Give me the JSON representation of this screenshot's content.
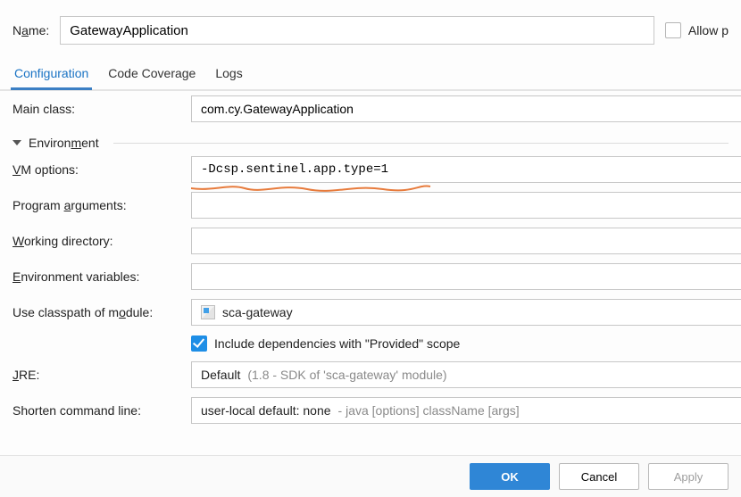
{
  "name": {
    "label_pre": "N",
    "label_u": "a",
    "label_post": "me:",
    "value": "GatewayApplication"
  },
  "allow": {
    "label": "Allow p",
    "checked": false
  },
  "tabs": {
    "t0": "Configuration",
    "t1": "Code Coverage",
    "t2": "Logs"
  },
  "mainClass": {
    "label": "Main class:",
    "value": "com.cy.GatewayApplication"
  },
  "env": {
    "title_pre": "Environ",
    "title_u": "m",
    "title_post": "ent"
  },
  "vm": {
    "label_u": "V",
    "label_post": "M options:",
    "value": "-Dcsp.sentinel.app.type=1"
  },
  "progArgs": {
    "label_pre": "Program ",
    "label_u": "a",
    "label_post": "rguments:",
    "value": ""
  },
  "workDir": {
    "label_u": "W",
    "label_post": "orking directory:",
    "value": ""
  },
  "envVars": {
    "label_u": "E",
    "label_post": "nvironment variables:",
    "value": ""
  },
  "module": {
    "label_pre": "Use classpath of m",
    "label_u": "o",
    "label_post": "dule:",
    "value": "sca-gateway"
  },
  "includeProvided": {
    "checked": true,
    "label": "Include dependencies with \"Provided\" scope"
  },
  "jre": {
    "label_u": "J",
    "label_post": "RE:",
    "value_prefix": "Default ",
    "value_grey": "(1.8 - SDK of 'sca-gateway' module)"
  },
  "shorten": {
    "label": "Shorten command line:",
    "value_prefix": "user-local default: none ",
    "value_grey": "- java [options] className [args]"
  },
  "buttons": {
    "ok": "OK",
    "cancel": "Cancel",
    "apply": "Apply"
  }
}
